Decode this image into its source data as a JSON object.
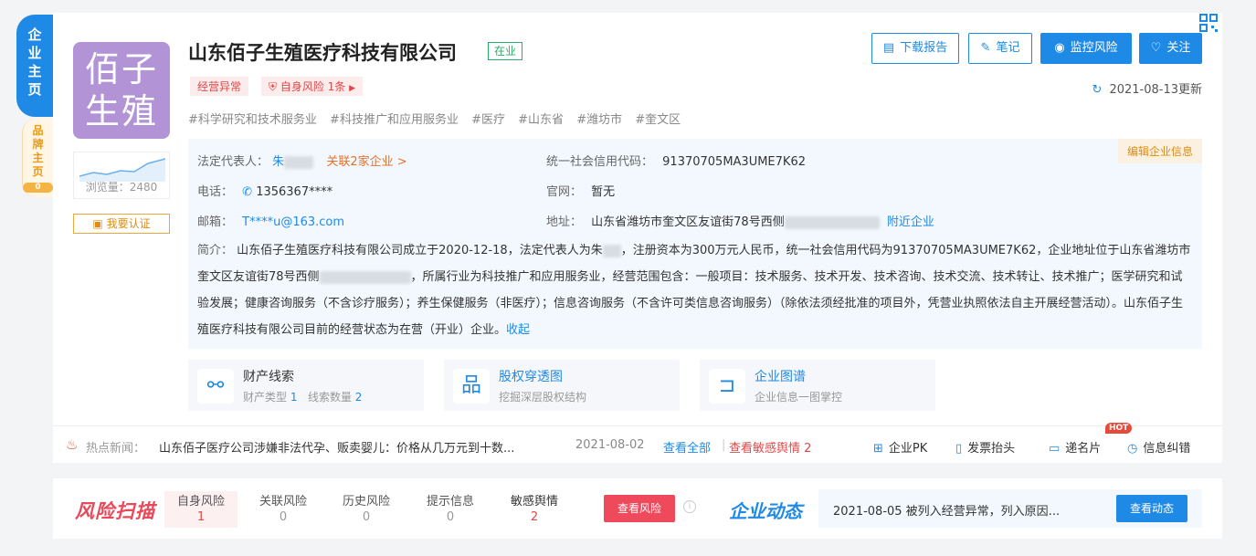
{
  "side": {
    "main_tab": [
      "企",
      "业",
      "主",
      "页"
    ],
    "brand_tab": [
      "品",
      "牌",
      "主",
      "页"
    ],
    "brand_count": "0"
  },
  "company": {
    "logo_text_line1": "佰子",
    "logo_text_line2": "生殖",
    "name": "山东佰子生殖医疗科技有限公司",
    "status": "在业",
    "views": "浏览量：2480",
    "verify": "我要认证",
    "tag_abnormal": "经营异常",
    "tag_risk": "自身风险 1条",
    "industries": [
      "#科学研究和技术服务业",
      "#科技推广和应用服务业",
      "#医疗",
      "#山东省",
      "#潍坊市",
      "#奎文区"
    ],
    "update_time": "2021-08-13更新"
  },
  "actions": {
    "download": "下载报告",
    "note": "笔记",
    "monitor": "监控风险",
    "follow": "关注"
  },
  "info": {
    "edit": "编辑企业信息",
    "legal_label": "法定代表人：",
    "legal_value": "朱",
    "legal_related": "关联2家企业 >",
    "credit_label": "统一社会信用代码：",
    "credit_value": "91370705MA3UME7K62",
    "phone_label": "电话：",
    "phone_value": "1356367****",
    "site_label": "官网：",
    "site_value": "暂无",
    "email_label": "邮箱：",
    "email_value": "T****u@163.com",
    "addr_label": "地址：",
    "addr_value": "山东省潍坊市奎文区友谊街78号西侧",
    "addr_near": "附近企业",
    "intro_label": "简介：",
    "intro_p1": "山东佰子生殖医疗科技有限公司成立于2020-12-18，法定代表人为朱",
    "intro_p2": "，注册资本为300万元人民币，统一社会信用代码为91370705MA3UME7K62，企业地址位于山东省潍坊市奎文区友谊街78号西侧",
    "intro_p3": "，所属行业为科技推广和应用服务业，经营范围包含：一般项目：技术服务、技术开发、技术咨询、技术交流、技术转让、技术推广；医学研究和试验发展；健康咨询服务（不含诊疗服务）；养生保健服务（非医疗）；信息咨询服务（不含许可类信息咨询服务）（除依法须经批准的项目外，凭营业执照依法自主开展经营活动）。山东佰子生殖医疗科技有限公司目前的经营状态为在营（开业）企业。",
    "collapse": "收起"
  },
  "features": [
    {
      "title": "财产线索",
      "sub_a": "财产类型",
      "sub_a_val": "1",
      "sub_b": "线索数量",
      "sub_b_val": "2"
    },
    {
      "title": "股权穿透图",
      "sub": "挖掘深层股权结构"
    },
    {
      "title": "企业图谱",
      "sub": "企业信息一图掌控"
    }
  ],
  "news": {
    "label": "热点新闻：",
    "text": "山东佰子医疗公司涉嫌非法代孕、贩卖婴儿：价格从几万元到十数...",
    "date": "2021-08-02",
    "all": "查看全部",
    "sep": "|",
    "sensitive": "查看敏感舆情 2"
  },
  "tools": {
    "pk": "企业PK",
    "invoice": "发票抬头",
    "card": "递名片",
    "hot": "HOT",
    "correct": "信息纠错"
  },
  "risk": {
    "logo": "风险扫描",
    "cells": [
      {
        "label": "自身风险",
        "value": "1"
      },
      {
        "label": "关联风险",
        "value": "0"
      },
      {
        "label": "历史风险",
        "value": "0"
      },
      {
        "label": "提示信息",
        "value": "0"
      },
      {
        "label": "敏感舆情",
        "value": "2"
      }
    ],
    "button": "查看风险",
    "info_glyph": "i"
  },
  "dynamic": {
    "logo": "企业动态",
    "text": "2021-08-05 被列入经营异常，列入原因...",
    "button": "查看动态"
  },
  "colors": {
    "primary": "#1f8ae6",
    "danger": "#e04848",
    "warning": "#e08b12",
    "success": "#2bad6a",
    "logo_bg": "#b294d6"
  }
}
